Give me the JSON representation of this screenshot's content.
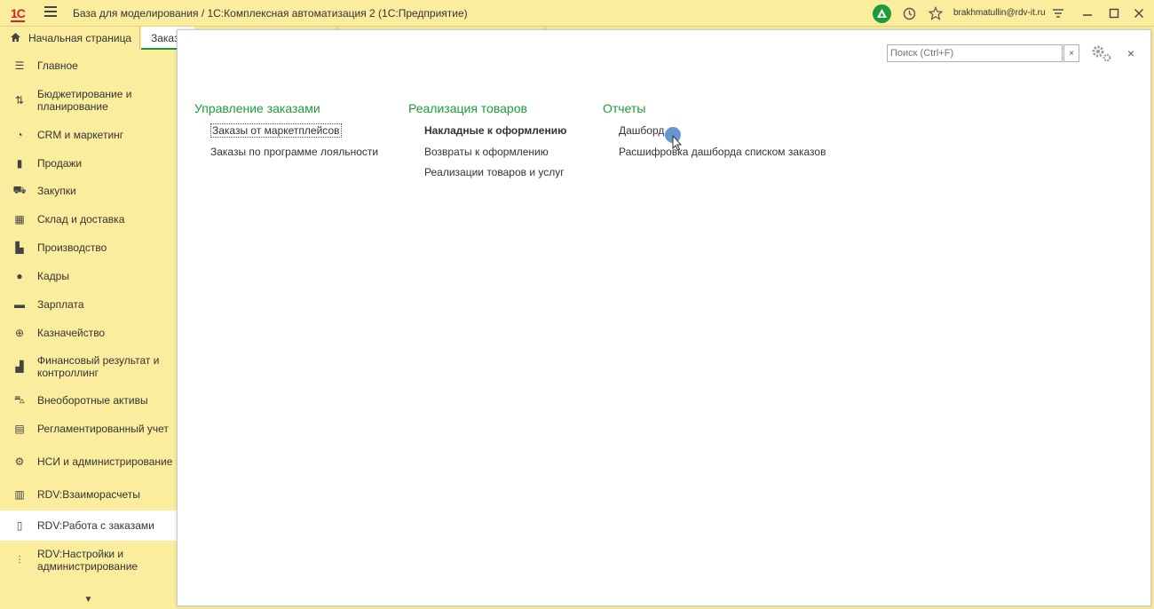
{
  "window": {
    "title": "База для моделирования / 1С:Комплексная автоматизация 2  (1С:Предприятие)",
    "logo_text": "1С",
    "user": "brakhmatullin@rdv-it.ru"
  },
  "tabs": {
    "home_label": "Начальная страница",
    "orders_label": "Заказы"
  },
  "sidebar": {
    "items": [
      {
        "label": "Главное",
        "icon": "list-icon",
        "glyph": "☰"
      },
      {
        "label": "Бюджетирование и планирование",
        "icon": "budget-icon",
        "glyph": "⇅"
      },
      {
        "label": "CRM и маркетинг",
        "icon": "pie-chart-icon",
        "glyph": "◔"
      },
      {
        "label": "Продажи",
        "icon": "bag-icon",
        "glyph": "▮"
      },
      {
        "label": "Закупки",
        "icon": "cart-icon",
        "glyph": "⛟"
      },
      {
        "label": "Склад и доставка",
        "icon": "warehouse-icon",
        "glyph": "▦"
      },
      {
        "label": "Производство",
        "icon": "factory-icon",
        "glyph": "▙"
      },
      {
        "label": "Кадры",
        "icon": "person-icon",
        "glyph": "●"
      },
      {
        "label": "Зарплата",
        "icon": "wallet-icon",
        "glyph": "▬"
      },
      {
        "label": "Казначейство",
        "icon": "coin-icon",
        "glyph": "⊕"
      },
      {
        "label": "Финансовый результат и контроллинг",
        "icon": "bar-chart-icon",
        "glyph": "▟"
      },
      {
        "label": "Внеоборотные активы",
        "icon": "car-icon",
        "glyph": "⛍"
      },
      {
        "label": "Регламентированный учет",
        "icon": "calculator-icon",
        "glyph": "▤"
      },
      {
        "label": "НСИ и администрирование",
        "icon": "gear-icon",
        "glyph": "⚙"
      },
      {
        "label": "RDV:Взаиморасчеты",
        "icon": "ledger-icon",
        "glyph": "▥"
      },
      {
        "label": "RDV:Работа с заказами",
        "icon": "document-icon",
        "glyph": "▯"
      },
      {
        "label": "RDV:Настройки и администрирование",
        "icon": "sliders-icon",
        "glyph": "⫶"
      }
    ]
  },
  "main": {
    "search_placeholder": "Поиск (Ctrl+F)",
    "sections": [
      {
        "title": "Управление заказами",
        "links": [
          "Заказы от маркетплейсов",
          "Заказы по программе лояльности"
        ]
      },
      {
        "title": "Реализация товаров",
        "links": [
          "Накладные к оформлению",
          "Возвраты к оформлению",
          "Реализации товаров и услуг"
        ]
      },
      {
        "title": "Отчеты",
        "links": [
          "Дашборд",
          "Расшифровка дашборда списком заказов"
        ]
      }
    ]
  },
  "colors": {
    "accent_green": "#1c9b3a",
    "sidebar_bg": "#fbed9e",
    "logo_red": "#d2232a"
  }
}
